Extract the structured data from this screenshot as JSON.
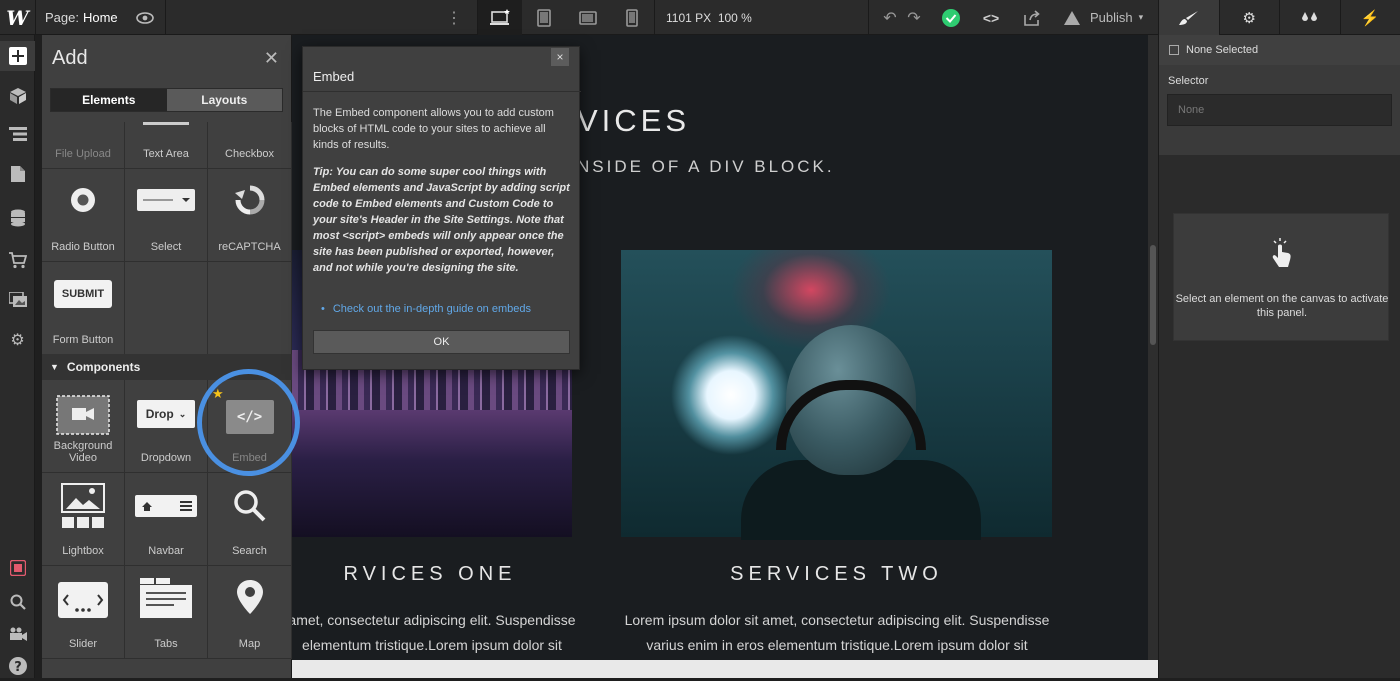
{
  "topbar": {
    "logo": "W",
    "page_label": "Page:",
    "page_name": "Home",
    "canvas_width": "1101 PX",
    "zoom": "100 %",
    "publish_label": "Publish",
    "devices": [
      "desktop-icon",
      "tablet-icon",
      "mobile-landscape-icon",
      "mobile-portrait-icon"
    ]
  },
  "right_tabs": [
    "brush-icon",
    "gear-icon",
    "drops-icon",
    "lightning-icon"
  ],
  "add_panel": {
    "title": "Add",
    "tabs": {
      "elements": "Elements",
      "layouts": "Layouts"
    },
    "forms_row0": [
      "File Upload",
      "Text Area",
      "Checkbox"
    ],
    "forms_row1": [
      "Radio Button",
      "Select",
      "reCAPTCHA"
    ],
    "forms_row2": [
      "Form Button"
    ],
    "submit_text": "SUBMIT",
    "components_header": "Components",
    "components": [
      {
        "label": "Background Video"
      },
      {
        "label": "Dropdown",
        "chip": "Drop"
      },
      {
        "label": "Embed",
        "chip": "</>"
      },
      {
        "label": "Lightbox"
      },
      {
        "label": "Navbar"
      },
      {
        "label": "Search"
      },
      {
        "label": "Slider"
      },
      {
        "label": "Tabs"
      },
      {
        "label": "Map"
      }
    ]
  },
  "canvas": {
    "heading": "VICES",
    "subheading": "NSIDE OF A DIV BLOCK.",
    "services_one": "RVICES ONE",
    "services_two": "SERVICES TWO",
    "para_one_1": "amet, consectetur adipiscing elit. Suspendisse",
    "para_one_2": "elementum tristique.Lorem ipsum dolor sit",
    "para_two_1": "Lorem ipsum dolor sit amet, consectetur adipiscing elit. Suspendisse",
    "para_two_2": "varius enim in eros elementum tristique.Lorem ipsum dolor sit"
  },
  "modal": {
    "title": "Embed",
    "close": "×",
    "body": "The Embed component allows you to add custom blocks of HTML code to your sites to achieve all kinds of results.",
    "tip": "Tip: You can do some super cool things with Embed elements and JavaScript by adding script code to Embed elements and Custom Code to your site's Header in the Site Settings. Note that most <script> embeds will only appear once the site has been published or exported, however, and not while you're designing the site.",
    "link": "Check out the in-depth guide on embeds",
    "ok": "OK"
  },
  "right_panel": {
    "none_selected": "None Selected",
    "selector_label": "Selector",
    "selector_placeholder": "None",
    "hint": "Select an element on the canvas to activate this panel."
  },
  "colors": {
    "highlight_ring": "#4a90e2",
    "publish_check": "#2ecc71",
    "link": "#61a8e8"
  }
}
